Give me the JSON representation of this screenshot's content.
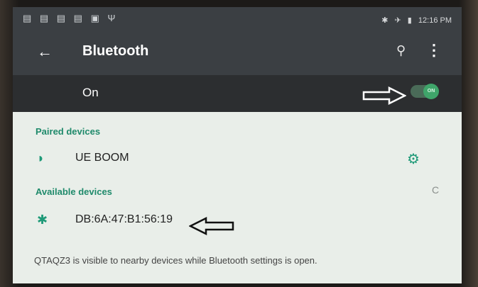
{
  "statusbar": {
    "left_icons": "▤ ▤ ▤ ▤ ▣ Ψ",
    "right_icons": [
      "✱",
      "✈",
      "▮"
    ],
    "time": "12:16 PM"
  },
  "appbar": {
    "back_icon": "←",
    "title": "Bluetooth",
    "search_icon": "⚲",
    "overflow_icon": "⋮"
  },
  "switch": {
    "label": "On",
    "toggle_text": "ON",
    "state": "on",
    "color": "#3fa56a"
  },
  "paired": {
    "header": "Paired devices",
    "items": [
      {
        "icon": "headphones-icon",
        "glyph": "◗",
        "label": "UE BOOM",
        "settings_glyph": "⚙"
      }
    ]
  },
  "available": {
    "header": "Available devices",
    "refresh_glyph": "C",
    "items": [
      {
        "icon": "bluetooth-icon",
        "glyph": "✱",
        "label": "DB:6A:47:B1:56:19"
      }
    ]
  },
  "footer": "QTAQZ3 is visible to nearby devices while Bluetooth settings is open.",
  "accent_color": "#1e9a78"
}
